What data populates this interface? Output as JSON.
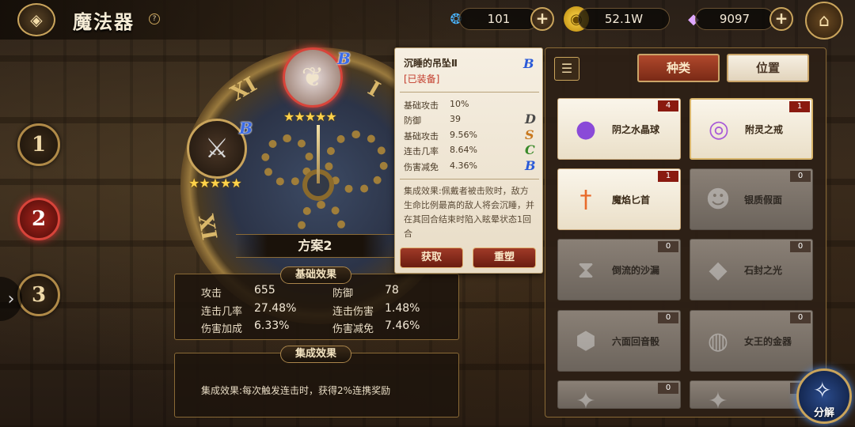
{
  "header": {
    "title": "魔法器",
    "help_icon": "?",
    "currencies": [
      {
        "name": "drop-currency",
        "icon": "water-drop-icon",
        "value": "101"
      },
      {
        "name": "gold",
        "icon": "gold-coin-icon",
        "value": "52.1W"
      },
      {
        "name": "diamond",
        "icon": "diamond-icon",
        "value": "9097"
      }
    ]
  },
  "sidebar": {
    "slots": [
      "1",
      "2",
      "3"
    ],
    "active_slot": "2"
  },
  "clock": {
    "plan_label": "方案2",
    "left_slot_grade": "B",
    "top_slot_grade": "B",
    "left_slot_stars": "★★★★★",
    "top_slot_stars": "★★★★★"
  },
  "base_stats": {
    "tab_label": "基础效果",
    "rows": [
      {
        "label1": "攻击",
        "value1": "655",
        "label2": "防御",
        "value2": "78"
      },
      {
        "label1": "连击几率",
        "value1": "27.48%",
        "label2": "连击伤害",
        "value2": "1.48%"
      },
      {
        "label1": "伤害加成",
        "value1": "6.33%",
        "label2": "伤害减免",
        "value2": "7.46%"
      }
    ]
  },
  "set_effect": {
    "tab_label": "集成效果",
    "text": "集成效果:每次触发连击时，获得2%连携奖励"
  },
  "tooltip": {
    "title": "沉睡的吊坠Ⅱ",
    "grade": "B",
    "equipped": "[已装备]",
    "stats": [
      {
        "label": "基础攻击",
        "value": "10%",
        "grade": ""
      },
      {
        "label": "防御",
        "value": "39",
        "grade": "D"
      },
      {
        "label": "基础攻击",
        "value": "9.56%",
        "grade": "S"
      },
      {
        "label": "连击几率",
        "value": "8.64%",
        "grade": "C"
      },
      {
        "label": "伤害减免",
        "value": "4.36%",
        "grade": "B"
      }
    ],
    "set_desc": "集成效果:佩戴者被击败时，敌方生命比例最高的敌人将会沉睡，并在其回合结束时陷入眩晕状态1回合",
    "btn_acquire": "获取",
    "btn_reforge": "重塑",
    "grade_colors": {
      "D": "#4a4a4a",
      "S": "#c8781e",
      "C": "#3a8a2a",
      "B": "#2a5ad8"
    }
  },
  "inventory": {
    "tab_type": "种类",
    "tab_position": "位置",
    "items": [
      {
        "name": "阴之水晶球",
        "count": "4",
        "owned": true,
        "icon": "crystal-ball-icon",
        "glyph": "🔮"
      },
      {
        "name": "附灵之戒",
        "count": "1",
        "owned": true,
        "icon": "ring-icon",
        "glyph": "💍"
      },
      {
        "name": "魔焰匕首",
        "count": "1",
        "owned": true,
        "icon": "dagger-icon",
        "glyph": "🗡"
      },
      {
        "name": "银质假面",
        "count": "0",
        "owned": false,
        "icon": "mask-icon",
        "glyph": "🎭"
      },
      {
        "name": "倒流的沙漏",
        "count": "0",
        "owned": false,
        "icon": "hourglass-icon",
        "glyph": "⌛"
      },
      {
        "name": "石封之光",
        "count": "0",
        "owned": false,
        "icon": "crystal-shard-icon",
        "glyph": "💎"
      },
      {
        "name": "六面回音骰",
        "count": "0",
        "owned": false,
        "icon": "dice-icon",
        "glyph": "⬢"
      },
      {
        "name": "女王的金器",
        "count": "0",
        "owned": false,
        "icon": "golden-plate-icon",
        "glyph": "🏺"
      },
      {
        "name": "",
        "count": "0",
        "owned": false,
        "icon": "unknown-item-icon",
        "glyph": "✦"
      },
      {
        "name": "",
        "count": "0",
        "owned": false,
        "icon": "unknown-item-icon",
        "glyph": "✦"
      }
    ]
  },
  "decompose": {
    "label": "分解"
  }
}
